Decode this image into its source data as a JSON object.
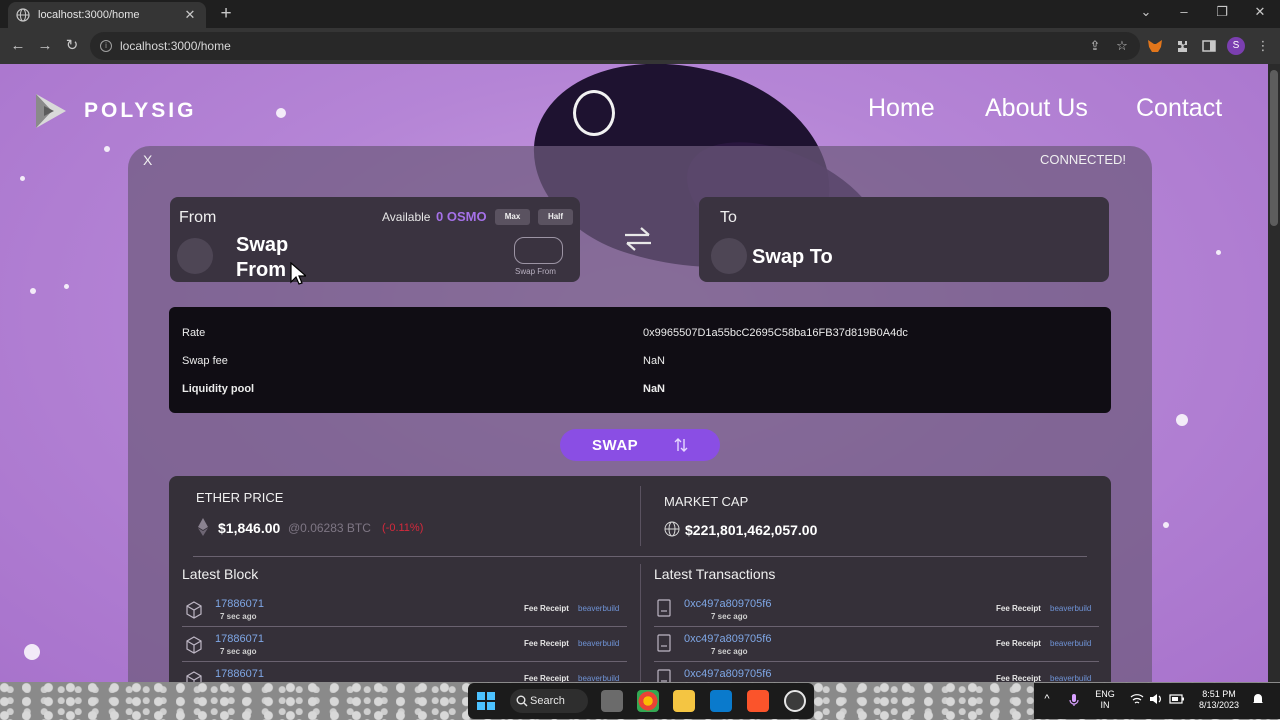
{
  "browser": {
    "tab_title": "localhost:3000/home",
    "tab_close": "✕",
    "new_tab": "+",
    "url": "localhost:3000/home",
    "controls": {
      "dropdown": "⌄",
      "minimize": "–",
      "maximize": "❐",
      "close": "✕"
    },
    "nav": {
      "back": "←",
      "forward": "→",
      "reload": "↻"
    },
    "toolbar_icons": [
      "share-icon",
      "bookmark-star-icon",
      "metamask-icon",
      "extensions-icon",
      "sidepanel-icon",
      "profile-avatar",
      "menu-icon"
    ],
    "star": "☆",
    "share": "⇪",
    "menu": "⋮",
    "profile_initial": "S"
  },
  "site": {
    "brand": "POLYSIG",
    "nav": [
      "Home",
      "About Us",
      "Contact"
    ]
  },
  "swap_card": {
    "close": "X",
    "status": "CONNECTED!",
    "from": {
      "label": "From",
      "available_label": "Available",
      "available_value": "0 OSMO",
      "max_label": "Max",
      "half_label": "Half",
      "token_line1": "Swap",
      "token_line2": "From",
      "input_label": "Swap From"
    },
    "to": {
      "label": "To",
      "token": "Swap To"
    },
    "info": {
      "rate_label": "Rate",
      "rate_value": "0x9965507D1a55bcC2695C58ba16FB37d819B0A4dc",
      "fee_label": "Swap fee",
      "fee_value": "NaN",
      "pool_label": "Liquidity pool",
      "pool_value": "NaN"
    },
    "swap_button": "SWAP"
  },
  "stats": {
    "ether_price_label": "ETHER PRICE",
    "ether_price": "$1,846.00",
    "ether_btc": "@0.06283 BTC",
    "ether_change": "(-0.11%)",
    "market_cap_label": "MARKET CAP",
    "market_cap": "$221,801,462,057.00",
    "latest_block_label": "Latest Block",
    "latest_tx_label": "Latest Transactions",
    "blocks": [
      {
        "number": "17886071",
        "ago": "7 sec ago",
        "fee": "Fee Receipt",
        "builder": "beaverbuild"
      },
      {
        "number": "17886071",
        "ago": "7 sec ago",
        "fee": "Fee Receipt",
        "builder": "beaverbuild"
      },
      {
        "number": "17886071",
        "ago": "",
        "fee": "Fee Receipt",
        "builder": "beaverbuild"
      }
    ],
    "transactions": [
      {
        "hash": "0xc497a809705f6",
        "ago": "7 sec ago",
        "fee": "Fee Receipt",
        "builder": "beaverbuild"
      },
      {
        "hash": "0xc497a809705f6",
        "ago": "7 sec ago",
        "fee": "Fee Receipt",
        "builder": "beaverbuild"
      },
      {
        "hash": "0xc497a809705f6",
        "ago": "",
        "fee": "Fee Receipt",
        "builder": "beaverbuild"
      }
    ]
  },
  "taskbar": {
    "search": "Search",
    "lang": "ENG",
    "region": "IN",
    "time": "8:51 PM",
    "date": "8/13/2023",
    "chevron": "^"
  },
  "colors": {
    "page_bg": "#b585d6",
    "accent": "#8a4ee4",
    "available": "#a571e8",
    "link": "#7fa7e6",
    "negative": "#d6293c"
  }
}
